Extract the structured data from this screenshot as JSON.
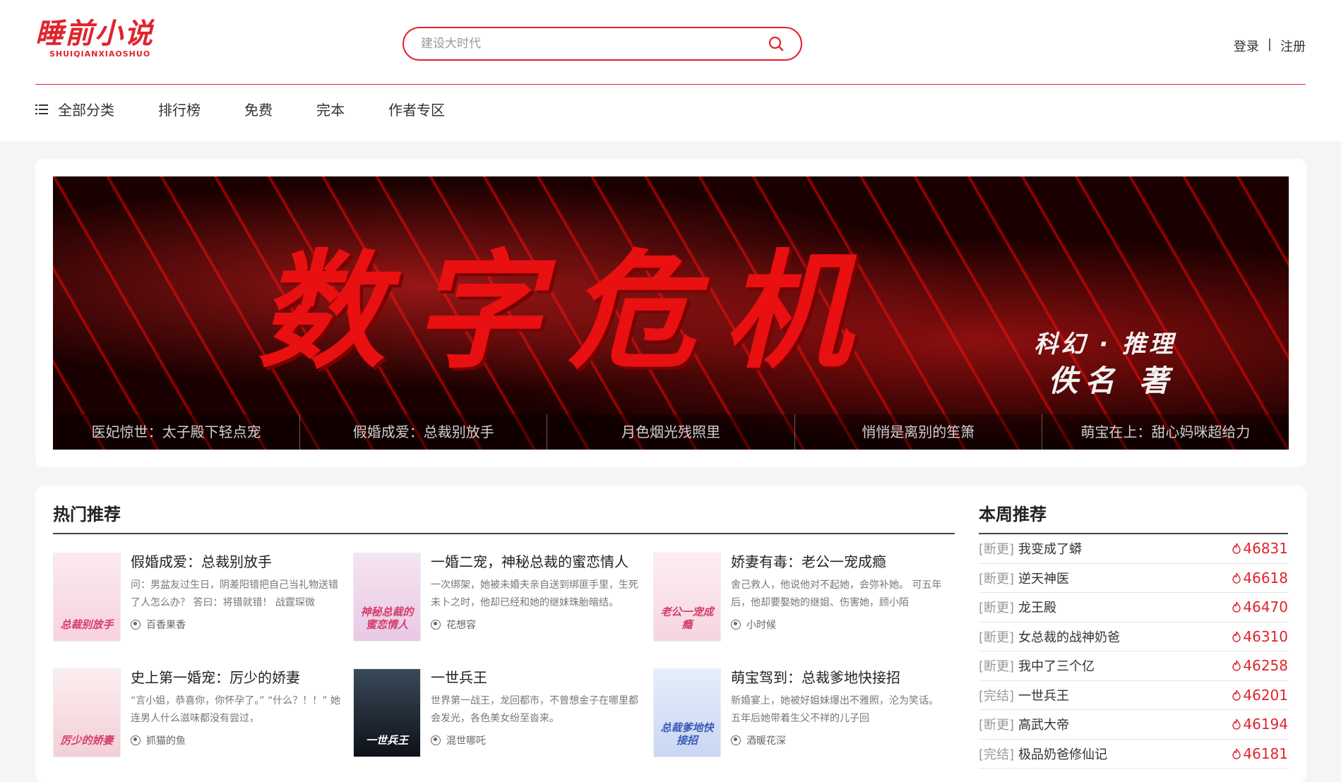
{
  "site": {
    "logo_cn": "睡前小说",
    "logo_en": "SHUIQIANXIAOSHUO",
    "brand_color": "#e0242e"
  },
  "search": {
    "placeholder": "建设大时代",
    "icon": "search-icon"
  },
  "auth": {
    "login": "登录",
    "separator": "|",
    "register": "注册"
  },
  "nav": {
    "items": [
      {
        "label": "全部分类",
        "icon": "menu-icon"
      },
      {
        "label": "排行榜"
      },
      {
        "label": "免费"
      },
      {
        "label": "完本"
      },
      {
        "label": "作者专区"
      }
    ]
  },
  "banner": {
    "title": "数字危机",
    "subtitle": "科幻 · 推理",
    "author": "佚名 著",
    "tabs": [
      "医妃惊世：太子殿下轻点宠",
      "假婚成爱：总裁别放手",
      "月色烟光残照里",
      "悄悄是离别的笙箫",
      "萌宝在上：甜心妈咪超给力"
    ]
  },
  "hot": {
    "title": "热门推荐",
    "books": [
      {
        "title": "假婚成爱：总裁别放手",
        "desc": "问：男盆友过生日，阴差阳错把自己当礼物送错了人怎么办？ 答曰：将错就错！ 战霆琛微",
        "author": "百香果香",
        "cover_text": "总裁别放手"
      },
      {
        "title": "一婚二宠，神秘总裁的蜜恋情人",
        "desc": "一次绑架，她被未婚夫亲自送到绑匪手里，生死未卜之时，他却已经和她的继妹珠胎暗结。",
        "author": "花想容",
        "cover_text": "神秘总裁的蜜恋情人"
      },
      {
        "title": "娇妻有毒：老公一宠成瘾",
        "desc": "舍己救人，他说他对不起她，会弥补她。 可五年后，他却要娶她的继姐、伤害她，顾小陌",
        "author": "小时候",
        "cover_text": "老公一宠成瘾"
      },
      {
        "title": "史上第一婚宠：厉少的娇妻",
        "desc": "“言小姐，恭喜你，你怀孕了。” “什么？！！” 她连男人什么滋味都没有尝过，",
        "author": "抓猫的鱼",
        "cover_text": "厉少的娇妻"
      },
      {
        "title": "一世兵王",
        "desc": "世界第一战王，龙回都市，不曾想金子在哪里都会发光，各色美女纷至沓来。",
        "author": "混世哪吒",
        "cover_text": "一世兵王"
      },
      {
        "title": "萌宝驾到：总裁爹地快接招",
        "desc": "新婚宴上，她被好姐妹爆出不雅照，沦为笑话。 五年后她带着生父不祥的儿子回",
        "author": "酒暖花深",
        "cover_text": "总裁爹地快接招"
      }
    ]
  },
  "weekly": {
    "title": "本周推荐",
    "items": [
      {
        "tag": "[断更]",
        "name": "我变成了蟒",
        "count": "46831"
      },
      {
        "tag": "[断更]",
        "name": "逆天神医",
        "count": "46618"
      },
      {
        "tag": "[断更]",
        "name": "龙王殿",
        "count": "46470"
      },
      {
        "tag": "[断更]",
        "name": "女总裁的战神奶爸",
        "count": "46310"
      },
      {
        "tag": "[断更]",
        "name": "我中了三个亿",
        "count": "46258"
      },
      {
        "tag": "[完结]",
        "name": "一世兵王",
        "count": "46201"
      },
      {
        "tag": "[断更]",
        "name": "高武大帝",
        "count": "46194"
      },
      {
        "tag": "[完结]",
        "name": "极品奶爸修仙记",
        "count": "46181"
      }
    ]
  }
}
